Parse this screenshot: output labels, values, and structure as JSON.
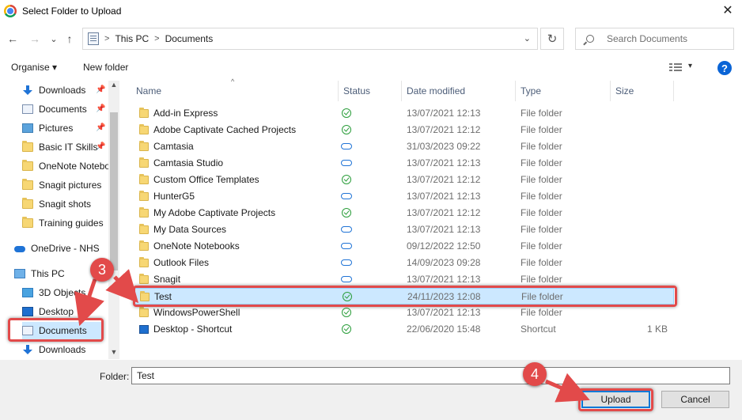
{
  "window": {
    "title": "Select Folder to Upload",
    "close_glyph": "✕"
  },
  "nav": {
    "back": "←",
    "forward": "→",
    "recent": "⌄",
    "up": "↑"
  },
  "address": {
    "segments": [
      "This PC",
      "Documents"
    ],
    "sep": ">",
    "dropdown": "⌄",
    "refresh": "↻"
  },
  "search": {
    "placeholder": "Search Documents"
  },
  "toolbar": {
    "organise": "Organise ▾",
    "new_folder": "New folder",
    "view_dd": "▾",
    "help": "?"
  },
  "navpane": {
    "items": [
      {
        "label": "Downloads",
        "icon": "download-icon",
        "pinned": true
      },
      {
        "label": "Documents",
        "icon": "document-icon",
        "pinned": true
      },
      {
        "label": "Pictures",
        "icon": "pictures-icon",
        "pinned": true
      },
      {
        "label": "Basic IT Skills",
        "icon": "folder-icon",
        "pinned": true
      },
      {
        "label": "OneNote Notebo",
        "icon": "folder-icon",
        "pinned": false
      },
      {
        "label": "Snagit pictures",
        "icon": "folder-icon",
        "pinned": false
      },
      {
        "label": "Snagit shots",
        "icon": "folder-icon",
        "pinned": false
      },
      {
        "label": "Training guides",
        "icon": "folder-icon",
        "pinned": false
      },
      {
        "label": "OneDrive - NHS",
        "icon": "cloud-icon",
        "pinned": false
      },
      {
        "label": "This PC",
        "icon": "pc-icon",
        "pinned": false
      },
      {
        "label": "3D Objects",
        "icon": "3d-objects-icon",
        "pinned": false
      },
      {
        "label": "Desktop",
        "icon": "desktop-icon",
        "pinned": false
      },
      {
        "label": "Documents",
        "icon": "document-icon",
        "pinned": false
      },
      {
        "label": "Downloads",
        "icon": "download-icon",
        "pinned": false
      }
    ],
    "pin_glyph": "📌"
  },
  "columns": {
    "name": "Name",
    "status": "Status",
    "date": "Date modified",
    "type": "Type",
    "size": "Size",
    "sort_glyph": "^"
  },
  "files": [
    {
      "name": "Add-in Express",
      "status": "synced",
      "date": "13/07/2021 12:13",
      "type": "File folder",
      "size": ""
    },
    {
      "name": "Adobe Captivate Cached Projects",
      "status": "synced",
      "date": "13/07/2021 12:12",
      "type": "File folder",
      "size": ""
    },
    {
      "name": "Camtasia",
      "status": "cloud",
      "date": "31/03/2023 09:22",
      "type": "File folder",
      "size": ""
    },
    {
      "name": "Camtasia Studio",
      "status": "cloud",
      "date": "13/07/2021 12:13",
      "type": "File folder",
      "size": ""
    },
    {
      "name": "Custom Office Templates",
      "status": "synced",
      "date": "13/07/2021 12:12",
      "type": "File folder",
      "size": ""
    },
    {
      "name": "HunterG5",
      "status": "cloud",
      "date": "13/07/2021 12:13",
      "type": "File folder",
      "size": ""
    },
    {
      "name": "My Adobe Captivate Projects",
      "status": "synced",
      "date": "13/07/2021 12:12",
      "type": "File folder",
      "size": ""
    },
    {
      "name": "My Data Sources",
      "status": "cloud",
      "date": "13/07/2021 12:13",
      "type": "File folder",
      "size": ""
    },
    {
      "name": "OneNote Notebooks",
      "status": "cloud",
      "date": "09/12/2022 12:50",
      "type": "File folder",
      "size": ""
    },
    {
      "name": "Outlook Files",
      "status": "cloud",
      "date": "14/09/2023 09:28",
      "type": "File folder",
      "size": ""
    },
    {
      "name": "Snagit",
      "status": "cloud",
      "date": "13/07/2021 12:13",
      "type": "File folder",
      "size": ""
    },
    {
      "name": "Test",
      "status": "synced",
      "date": "24/11/2023 12:08",
      "type": "File folder",
      "size": "",
      "selected": true
    },
    {
      "name": "WindowsPowerShell",
      "status": "synced",
      "date": "13/07/2021 12:13",
      "type": "File folder",
      "size": ""
    },
    {
      "name": "Desktop - Shortcut",
      "status": "synced",
      "date": "22/06/2020 15:48",
      "type": "Shortcut",
      "size": "1 KB"
    }
  ],
  "footer": {
    "folder_label": "Folder:",
    "folder_value": "Test",
    "upload": "Upload",
    "cancel": "Cancel"
  },
  "annotations": {
    "step3": "3",
    "step4": "4",
    "color": "#e24a4a"
  }
}
